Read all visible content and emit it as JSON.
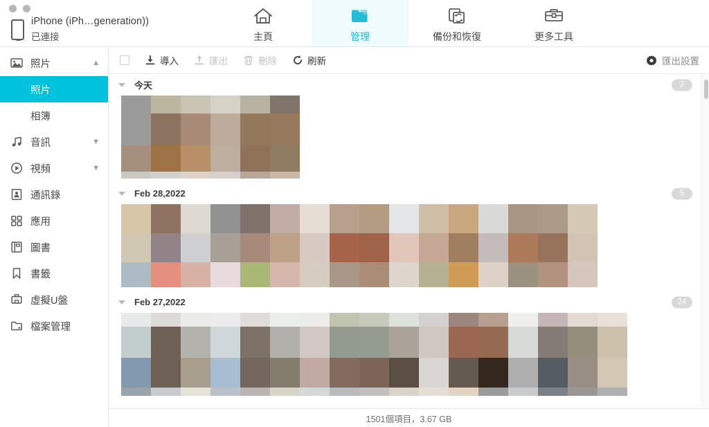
{
  "window": {
    "dots": [
      "minimize",
      "maximize"
    ]
  },
  "device": {
    "name": "iPhone (iPh…generation))",
    "status": "已連接",
    "icon": "phone-icon"
  },
  "nav": {
    "tabs": [
      {
        "label": "主頁",
        "icon": "home-icon",
        "active": false
      },
      {
        "label": "管理",
        "icon": "folder-icon",
        "active": true
      },
      {
        "label": "備份和恢復",
        "icon": "backup-restore-icon",
        "active": false
      },
      {
        "label": "更多工具",
        "icon": "toolbox-icon",
        "active": false
      }
    ],
    "accent": "#22bdd9"
  },
  "sidebar": {
    "items": [
      {
        "label": "照片",
        "icon": "photo-icon",
        "chevron": "▲",
        "type": "group"
      },
      {
        "label": "照片",
        "type": "sub",
        "active": true
      },
      {
        "label": "相簿",
        "type": "sub",
        "active": false
      },
      {
        "label": "音訊",
        "icon": "music-icon",
        "chevron": "▼",
        "type": "group"
      },
      {
        "label": "視頻",
        "icon": "video-icon",
        "chevron": "▼",
        "type": "group"
      },
      {
        "label": "通訊錄",
        "icon": "contacts-icon",
        "type": "item"
      },
      {
        "label": "應用",
        "icon": "apps-icon",
        "type": "item"
      },
      {
        "label": "圖書",
        "icon": "books-icon",
        "type": "item"
      },
      {
        "label": "書籤",
        "icon": "bookmark-icon",
        "type": "item"
      },
      {
        "label": "虛擬U盤",
        "icon": "usb-drive-icon",
        "type": "item"
      },
      {
        "label": "檔案管理",
        "icon": "file-manager-icon",
        "type": "item"
      }
    ],
    "active_color": "#00c2dd"
  },
  "toolbar": {
    "select_all_checked": false,
    "buttons": [
      {
        "label": "導入",
        "icon": "import-icon",
        "enabled": true
      },
      {
        "label": "匯出",
        "icon": "export-icon",
        "enabled": false
      },
      {
        "label": "刪除",
        "icon": "trash-icon",
        "enabled": false
      },
      {
        "label": "刷新",
        "icon": "refresh-icon",
        "enabled": true
      }
    ],
    "export_settings": {
      "label": "匯出設置",
      "icon": "gear-icon"
    }
  },
  "groups": [
    {
      "title": "今天",
      "count": "2",
      "thumbs": [
        [
          "#9b9b9b",
          "#9b9b9b",
          "#a5907f",
          "#cbc8c2"
        ],
        [
          "#bcb6a1",
          "#8d7460",
          "#9e7446",
          "#d2d0cd"
        ],
        [
          "#c9c4b4",
          "#a78b76",
          "#b98f67",
          "#ddd3cb"
        ],
        [
          "#d7d2c8",
          "#bdac9c",
          "#bdaea0",
          "#d6cfcb"
        ],
        [
          "#b8b2a3",
          "#93785c",
          "#8f7258",
          "#b9a698"
        ],
        [
          "#80746b",
          "#987košt",
          "#8f7a62",
          "#cbb6a8"
        ]
      ]
    },
    {
      "title": "Feb 28,2022",
      "count": "5",
      "thumbs": [
        [
          "#d6c7a8",
          "#d0c8b2",
          "#adbcc4"
        ],
        [
          "#8f7361",
          "#918388",
          "#e5907f"
        ],
        [
          "#ded9d3",
          "#cecfd0",
          "#d7b0a6"
        ],
        [
          "#929292",
          "#a8a096",
          "#e9dadd"
        ],
        [
          "#7e726a",
          "#a88a7c",
          "#a9b877"
        ],
        [
          "#c2ada4",
          "#bda287",
          "#d5b7ab"
        ],
        [
          "#e6ddd4",
          "#d6cac2",
          "#d7ccc1"
        ],
        [
          "#b9a08c",
          "#a5644a",
          "#a9978a"
        ],
        [
          "#b39c82",
          "#a1624a",
          "#ab8c77"
        ],
        [
          "#e5e6e7",
          "#e0c7ba",
          "#ded5cd"
        ],
        [
          "#cfbda6",
          "#c6a795",
          "#b4b291"
        ],
        [
          "#c9a87f",
          "#a07f61",
          "#cf9c56"
        ],
        [
          "#d9d9d8",
          "#c3bcba",
          "#ddd1c8"
        ],
        [
          "#a89684",
          "#ac7a58",
          "#9b9180"
        ],
        [
          "#ac9b89",
          "#96735a",
          "#b3937f"
        ],
        [
          "#d5c9b5",
          "#d2c3b5",
          "#d6c6bd"
        ]
      ]
    },
    {
      "title": "Feb 27,2022",
      "count": "24",
      "thumbs": [
        [
          "#e7eae8",
          "#c2cdcd",
          "#8399b0",
          "#9ba4ad"
        ],
        [
          "#dddbd8",
          "#6e6055",
          "#6e6055",
          "#c9cacb"
        ],
        [
          "#ebebe9",
          "#b4b2ad",
          "#a79e8d",
          "#e7e3d8"
        ],
        [
          "#ececec",
          "#ced7d9",
          "#a8bdd0",
          "#b9c1cb"
        ],
        [
          "#dedddb",
          "#7d7168",
          "#74675f",
          "#bab4b2"
        ],
        [
          "#eceeea",
          "#b1b0ab",
          "#847c6c",
          "#d8d5c7"
        ],
        [
          "#ececea",
          "#d3c8c4",
          "#c1aaa4",
          "#d6d7d8"
        ],
        [
          "#c2c4b2",
          "#939a8f",
          "#836c5f",
          "#babbbc"
        ],
        [
          "#c8cbbb",
          "#949b90",
          "#7d6457",
          "#c0c0bf"
        ],
        [
          "#dde2dc",
          "#aaa39a",
          "#5a4e45",
          "#d9d4c9"
        ],
        [
          "#d6d1d1",
          "#cfc7c1",
          "#dad6d3",
          "#e5ded7"
        ],
        [
          "#9b8680",
          "#9c6752",
          "#655a51",
          "#e3d3c5"
        ],
        [
          "#b7a08f",
          "#946a51",
          "#33271e",
          "#9b9b9c"
        ],
        [
          "#efefed",
          "#d8dad7",
          "#afafaf",
          "#cacbcc"
        ],
        [
          "#c4b5b7",
          "#837b76",
          "#565c64",
          "#7b8187"
        ],
        [
          "#e3dbd2",
          "#958e7c",
          "#998e86",
          "#9a9694"
        ],
        [
          "#e9e0da",
          "#cdc1ac",
          "#d4c7b4",
          "#aeafb1"
        ]
      ]
    }
  ],
  "statusbar": {
    "text": "1501個項目，3.67 GB"
  },
  "scrollbar": {
    "name": "vertical-scrollbar"
  }
}
